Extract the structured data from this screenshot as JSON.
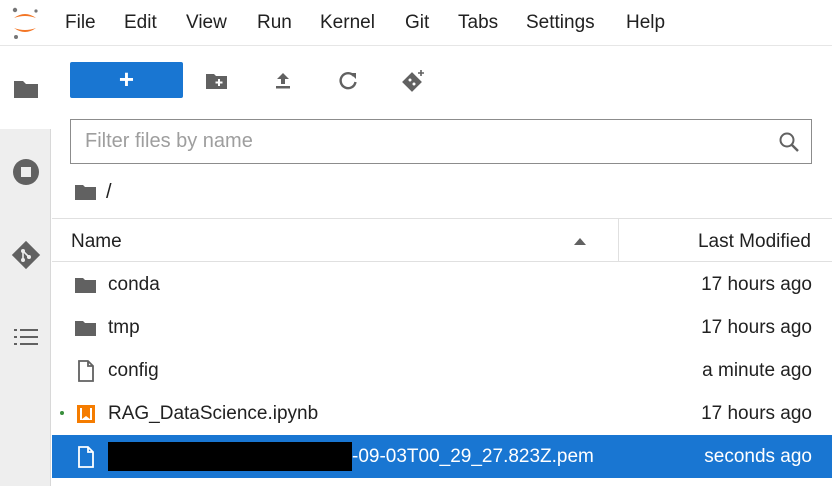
{
  "menu": [
    "File",
    "Edit",
    "View",
    "Run",
    "Kernel",
    "Git",
    "Tabs",
    "Settings",
    "Help"
  ],
  "toolbar": {
    "new_label": "+",
    "icons": [
      "new-folder-icon",
      "upload-icon",
      "refresh-icon",
      "git-clone-icon"
    ]
  },
  "filter": {
    "placeholder": "Filter files by name",
    "value": ""
  },
  "breadcrumb": {
    "path": "/"
  },
  "table": {
    "name_header": "Name",
    "modified_header": "Last Modified",
    "sort": "ascending"
  },
  "files": [
    {
      "name": "conda",
      "modified": "17 hours ago",
      "type": "folder"
    },
    {
      "name": "tmp",
      "modified": "17 hours ago",
      "type": "folder"
    },
    {
      "name": "config",
      "modified": "a minute ago",
      "type": "file"
    },
    {
      "name": "RAG_DataScience.ipynb",
      "modified": "17 hours ago",
      "type": "notebook",
      "running": true
    },
    {
      "name": "-09-03T00_29_27.823Z.pem",
      "modified": "seconds ago",
      "type": "file",
      "selected": true,
      "redacted_prefix": true
    }
  ],
  "colors": {
    "accent": "#1976d2",
    "logo": "#f37626",
    "notebook": "#f57c00",
    "running_dot": "#388e3c",
    "icon": "#616161"
  }
}
